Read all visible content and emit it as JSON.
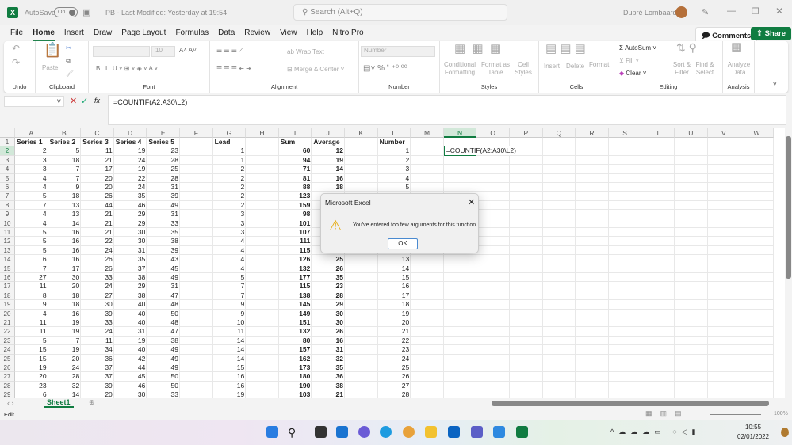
{
  "titlebar": {
    "autosave": "AutoSave",
    "toggle": "On",
    "doc_title": "PB  -  Last Modified: Yesterday at 19:54",
    "search_placeholder": "Search (Alt+Q)",
    "user": "Dupré Lombaard"
  },
  "menu": [
    "File",
    "Home",
    "Insert",
    "Draw",
    "Page Layout",
    "Formulas",
    "Data",
    "Review",
    "View",
    "Help",
    "Nitro Pro"
  ],
  "buttons": {
    "comments": "Comments",
    "share": "Share"
  },
  "ribbon": {
    "groups": {
      "undo": "Undo",
      "clipboard": "Clipboard",
      "font": "Font",
      "alignment": "Alignment",
      "number": "Number",
      "styles": "Styles",
      "cells": "Cells",
      "editing": "Editing",
      "analysis": "Analysis"
    },
    "paste": "Paste",
    "font_size": "10",
    "wrap_text": "Wrap Text",
    "merge_center": "Merge & Center",
    "number_format": "Number",
    "conditional": "Conditional Formatting",
    "format_table": "Format as Table",
    "cell_styles": "Cell Styles",
    "insert": "Insert",
    "delete": "Delete",
    "format": "Format",
    "autosum": "AutoSum",
    "fill": "Fill",
    "clear": "Clear",
    "sort_filter": "Sort & Filter",
    "find_select": "Find & Select",
    "analyze": "Analyze Data"
  },
  "formula_bar": {
    "fx": "fx",
    "formula": "=COUNTIF(A2:A30\\L2)"
  },
  "columns": [
    "A",
    "B",
    "C",
    "D",
    "E",
    "F",
    "G",
    "H",
    "I",
    "J",
    "K",
    "L",
    "M",
    "N",
    "O",
    "P",
    "Q",
    "R",
    "S",
    "T",
    "U",
    "V",
    "W"
  ],
  "headers": {
    "A": "Series 1",
    "B": "Series 2",
    "C": "Series 3",
    "D": "Series 4",
    "E": "Series 5",
    "G": "Lead",
    "I": "Sum",
    "J": "Average",
    "L": "Number"
  },
  "rows": [
    [
      2,
      5,
      11,
      19,
      23,
      1,
      60,
      12,
      1
    ],
    [
      3,
      18,
      21,
      24,
      28,
      1,
      94,
      19,
      2
    ],
    [
      3,
      7,
      17,
      19,
      25,
      2,
      71,
      14,
      3
    ],
    [
      4,
      7,
      20,
      22,
      28,
      2,
      81,
      16,
      4
    ],
    [
      4,
      9,
      20,
      24,
      31,
      2,
      88,
      18,
      5
    ],
    [
      5,
      18,
      26,
      35,
      39,
      2,
      123,
      null,
      null
    ],
    [
      7,
      13,
      44,
      46,
      49,
      2,
      159,
      null,
      null
    ],
    [
      4,
      13,
      21,
      29,
      31,
      3,
      98,
      null,
      null
    ],
    [
      4,
      14,
      21,
      29,
      33,
      3,
      101,
      null,
      null
    ],
    [
      5,
      16,
      21,
      30,
      35,
      3,
      107,
      null,
      null
    ],
    [
      5,
      16,
      22,
      30,
      38,
      4,
      111,
      null,
      null
    ],
    [
      5,
      16,
      24,
      31,
      39,
      4,
      115,
      null,
      null
    ],
    [
      6,
      16,
      26,
      35,
      43,
      4,
      126,
      25,
      13
    ],
    [
      7,
      17,
      26,
      37,
      45,
      4,
      132,
      26,
      14
    ],
    [
      27,
      30,
      33,
      38,
      49,
      5,
      177,
      35,
      15
    ],
    [
      11,
      20,
      24,
      29,
      31,
      7,
      115,
      23,
      16
    ],
    [
      8,
      18,
      27,
      38,
      47,
      7,
      138,
      28,
      17
    ],
    [
      9,
      18,
      30,
      40,
      48,
      9,
      145,
      29,
      18
    ],
    [
      4,
      16,
      39,
      40,
      50,
      9,
      149,
      30,
      19
    ],
    [
      11,
      19,
      33,
      40,
      48,
      10,
      151,
      30,
      20
    ],
    [
      11,
      19,
      24,
      31,
      47,
      11,
      132,
      26,
      21
    ],
    [
      5,
      7,
      11,
      19,
      38,
      14,
      80,
      16,
      22
    ],
    [
      15,
      19,
      34,
      40,
      49,
      14,
      157,
      31,
      23
    ],
    [
      15,
      20,
      36,
      42,
      49,
      14,
      162,
      32,
      24
    ],
    [
      19,
      24,
      37,
      44,
      49,
      15,
      173,
      35,
      25
    ],
    [
      20,
      28,
      37,
      45,
      50,
      16,
      180,
      36,
      26
    ],
    [
      23,
      32,
      39,
      46,
      50,
      16,
      190,
      38,
      27
    ],
    [
      6,
      14,
      20,
      30,
      33,
      19,
      103,
      21,
      28
    ]
  ],
  "active_cell": {
    "ref": "N2",
    "value": "=COUNTIF(A2:A30\\L2)"
  },
  "dialog": {
    "title": "Microsoft Excel",
    "message": "You've entered too few arguments for this function.",
    "ok": "OK"
  },
  "sheet_tabs": [
    "Sheet1"
  ],
  "status": {
    "mode": "Edit",
    "zoom": "100%"
  },
  "taskbar": {
    "time": "10:55",
    "date": "02/01/2022"
  }
}
